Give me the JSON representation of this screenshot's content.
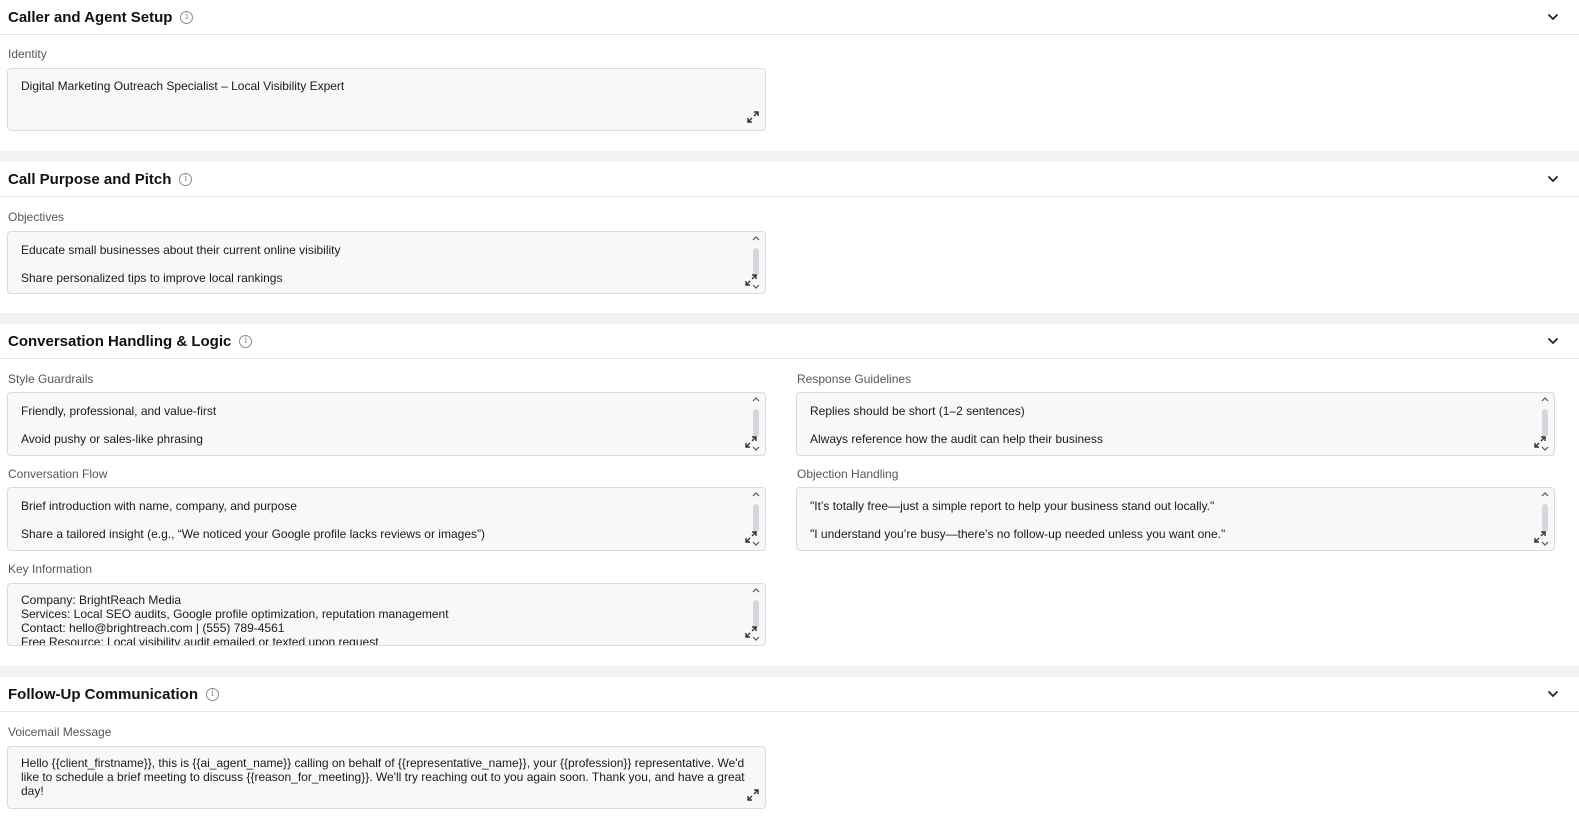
{
  "sections": {
    "caller": {
      "title": "Caller and Agent Setup",
      "identity_label": "Identity",
      "identity_value": "Digital Marketing Outreach Specialist – Local Visibility Expert"
    },
    "purpose": {
      "title": "Call Purpose and Pitch",
      "objectives_label": "Objectives",
      "objectives_value": "Educate small businesses about their current online visibility\nShare personalized tips to improve local rankings"
    },
    "conversation": {
      "title": "Conversation Handling & Logic",
      "style_label": "Style Guardrails",
      "style_value": "Friendly, professional, and value-first\nAvoid pushy or sales-like phrasing",
      "response_label": "Response Guidelines",
      "response_value": "Replies should be short (1–2 sentences)\nAlways reference how the audit can help their business",
      "flow_label": "Conversation Flow",
      "flow_value": "Brief introduction with name, company, and purpose\nShare a tailored insight (e.g., “We noticed your Google profile lacks reviews or images”)",
      "objection_label": "Objection Handling",
      "objection_value": "\"It’s totally free—just a simple report to help your business stand out locally.\"\n\"I understand you’re busy—there’s no follow-up needed unless you want one.\"",
      "keyinfo_label": "Key Information",
      "keyinfo_value": "Company: BrightReach Media\nServices: Local SEO audits, Google profile optimization, reputation management\nContact: hello@brightreach.com | (555) 789-4561\nFree Resource: Local visibility audit emailed or texted upon request"
    },
    "followup": {
      "title": "Follow-Up Communication",
      "voicemail_label": "Voicemail Message",
      "voicemail_value": "Hello {{client_firstname}}, this is {{ai_agent_name}} calling on behalf of {{representative_name}}, your {{profession}} representative. We'd like to schedule a brief meeting to discuss {{reason_for_meeting}}. We'll try reaching out to you again soon. Thank you, and have a great day!"
    }
  },
  "icons": {
    "info": "info-icon",
    "chevron": "chevron-down-icon",
    "expand": "expand-icon"
  }
}
